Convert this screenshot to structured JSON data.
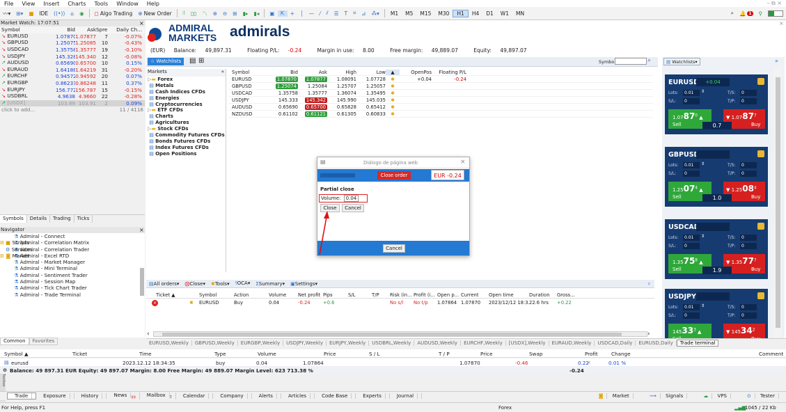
{
  "menu": [
    "File",
    "View",
    "Insert",
    "Charts",
    "Tools",
    "Window",
    "Help"
  ],
  "window_controls": "– ⧉ ×",
  "toolbar": {
    "ide": "IDE",
    "algo_trading": "Algo Trading",
    "new_order": "New Order",
    "timeframes": [
      "M1",
      "M5",
      "M15",
      "M30",
      "H1",
      "H4",
      "D1",
      "W1",
      "MN"
    ],
    "active_timeframe": "H1",
    "notification_count": "1"
  },
  "market_watch": {
    "title": "Market Watch: 17:07:51",
    "columns": [
      "Symbol",
      "Bid",
      "Ask",
      "Spre...",
      "Daily Ch..."
    ],
    "rows": [
      {
        "symbol": "EURUSD",
        "bid": "1.07870",
        "ask": "1.07877",
        "spread": "7",
        "change": "-0.07%"
      },
      {
        "symbol": "GBPUSD",
        "bid": "1.25075",
        "ask": "1.25085",
        "spread": "10",
        "change": "-0.43%"
      },
      {
        "symbol": "USDCAD",
        "bid": "1.35758",
        "ask": "1.35777",
        "spread": "19",
        "change": "-0.10%"
      },
      {
        "symbol": "USDJPY",
        "bid": "145.328",
        "ask": "145.340",
        "spread": "12",
        "change": "-0.08%"
      },
      {
        "symbol": "AUDUSD",
        "bid": "0.65690",
        "ask": "0.65700",
        "spread": "10",
        "change": "0.15%"
      },
      {
        "symbol": "EURAUD",
        "bid": "1.64188",
        "ask": "1.64219",
        "spread": "31",
        "change": "-0.20%"
      },
      {
        "symbol": "EURCHF",
        "bid": "0.94572",
        "ask": "0.94592",
        "spread": "20",
        "change": "0.07%"
      },
      {
        "symbol": "EURGBP",
        "bid": "0.86237",
        "ask": "0.86248",
        "spread": "11",
        "change": "0.37%"
      },
      {
        "symbol": "EURJPY",
        "bid": "156.772",
        "ask": "156.787",
        "spread": "15",
        "change": "-0.15%"
      },
      {
        "symbol": "USDBRL",
        "bid": "4.9638",
        "ask": "4.9660",
        "spread": "22",
        "change": "-0.28%"
      },
      {
        "symbol": "[USDX]",
        "bid": "103.89",
        "ask": "103.91",
        "spread": "2",
        "change": "0.09%"
      }
    ],
    "add_row": "click to add...",
    "count": "11 / 4116",
    "tabs": [
      "Symbols",
      "Details",
      "Trading",
      "Ticks"
    ]
  },
  "navigator": {
    "title": "Navigator",
    "items": [
      "Admiral - Connect",
      "Admiral - Correlation Matrix",
      "Admiral - Correlation Trader",
      "Admiral - Excel RTD",
      "Admiral - Market Manager",
      "Admiral - Mini Terminal",
      "Admiral - Sentiment Trader",
      "Admiral - Session Map",
      "Admiral - Tick Chart Trader",
      "Admiral - Trade Terminal"
    ],
    "folders": [
      "Scripts",
      "Services",
      "Market"
    ],
    "tabs": [
      "Common",
      "Favorites"
    ]
  },
  "brand": {
    "logo_line1": "ADMIRAL",
    "logo_line2": "MARKETS",
    "logo_word": "admirals"
  },
  "account": {
    "currency": "(EUR)",
    "balance_label": "Balance:",
    "balance": "49,897.31",
    "fpl_label": "Floating P/L:",
    "fpl": "-0.24",
    "margin_label": "Margin in use:",
    "margin": "8.00",
    "free_label": "Free margin:",
    "free": "49,889.07",
    "equity_label": "Equity:",
    "equity": "49,897.07"
  },
  "watchlist": {
    "tab_label": "Watchlists",
    "symbol_label": "Symbol:",
    "markets_title": "Markets",
    "markets": [
      "Forex",
      "Metals",
      "Cash Indices CFDs",
      "Energies",
      "Cryptocurrencies",
      "ETF CFDs",
      "Charts",
      "Agricultures",
      "Stock CFDs",
      "Commodity Futures CFDs",
      "Bonds Futures CFDs",
      "Index Futures CFDs",
      "Open Positions"
    ],
    "columns": [
      "Symbol",
      "Bid",
      "Ask",
      "High",
      "Low",
      "▲",
      "OpenPos",
      "Floating P/L"
    ],
    "rows": [
      {
        "symbol": "EURUSD",
        "bid": "1.07870",
        "ask": "1.07877",
        "high": "1.08091",
        "low": "1.07728",
        "openpos": "+0.04",
        "fpl": "-0.24",
        "bid_style": "pg",
        "ask_style": "pg"
      },
      {
        "symbol": "GBPUSD",
        "bid": "1.25074",
        "ask": "1.25084",
        "high": "1.25707",
        "low": "1.25057",
        "openpos": "",
        "fpl": "",
        "bid_style": "pg",
        "ask_style": ""
      },
      {
        "symbol": "USDCAD",
        "bid": "1.35758",
        "ask": "1.35777",
        "high": "1.36074",
        "low": "1.35495",
        "openpos": "",
        "fpl": "",
        "bid_style": "",
        "ask_style": ""
      },
      {
        "symbol": "USDJPY",
        "bid": "145.333",
        "ask": "145.342",
        "high": "145.990",
        "low": "145.035",
        "openpos": "",
        "fpl": "",
        "bid_style": "",
        "ask_style": "pr"
      },
      {
        "symbol": "AUDUSD",
        "bid": "0.65690",
        "ask": "0.65700",
        "high": "0.65828",
        "low": "0.65412",
        "openpos": "",
        "fpl": "",
        "bid_style": "",
        "ask_style": "pr"
      },
      {
        "symbol": "NZDUSD",
        "bid": "0.61102",
        "ask": "0.61121",
        "high": "0.61305",
        "low": "0.60833",
        "openpos": "",
        "fpl": "",
        "bid_style": "",
        "ask_style": "pg"
      }
    ]
  },
  "dialog": {
    "title": "Diálogo de página web",
    "close_order": "Close order",
    "amount": "EUR -0.24",
    "partial": "Partial close",
    "volume_label": "Volume:",
    "volume_value": "0.04",
    "close_btn": "Close",
    "cancel_btn": "Cancel",
    "cancel_bottom": "Cancel"
  },
  "orders": {
    "toolbar": [
      "All orders",
      "Close",
      "Tools",
      "OCA",
      "Summary",
      "Settings"
    ],
    "columns": [
      "Ticket ▲",
      "",
      "Symbol",
      "Action",
      "Volume",
      "Net profit",
      "Pips",
      "S/L",
      "T/P",
      "Risk (in...",
      "Profit (i...",
      "Open p...",
      "Current",
      "Open time",
      "Duration",
      "Gross..."
    ],
    "row": [
      "",
      "",
      "EURUSD",
      "Buy",
      "0.04",
      "-0.24",
      "+0.6",
      "",
      "",
      "No s/l",
      "No t/p",
      "1.07864",
      "1.07870",
      "2023/12/12 18:3...",
      "22.6 hrs",
      "+0.22"
    ]
  },
  "chart_tabs": [
    "EURUSD,Weekly",
    "GBPUSD,Weekly",
    "EURGBP,Weekly",
    "USDJPY,Weekly",
    "EURJPY,Weekly",
    "USDBRL,Weekly",
    "AUDUSD,Weekly",
    "EURCHF,Weekly",
    "[USDX],Weekly",
    "EURAUD,Weekly",
    "USDCAD,Daily",
    "EURUSD,Daily",
    "Trade terminal"
  ],
  "panels": [
    {
      "name": "EURUSD",
      "change": "+0.04",
      "lots": "0.01",
      "ts": "0",
      "sl": "0",
      "tp": "0",
      "sell_small": "1.07",
      "sell_big": "87",
      "sell_sup": "0",
      "buy_small": "1.07",
      "buy_big": "87",
      "buy_sup": "7",
      "spread": "0.7",
      "sell": "Sell",
      "buy": "Buy"
    },
    {
      "name": "GBPUSD",
      "change": "",
      "lots": "0.01",
      "ts": "0",
      "sl": "0",
      "tp": "0",
      "sell_small": "1.25",
      "sell_big": "07",
      "sell_sup": "4",
      "buy_small": "1.25",
      "buy_big": "08",
      "buy_sup": "4",
      "spread": "1.0",
      "sell": "Sell",
      "buy": "Buy"
    },
    {
      "name": "USDCAD",
      "change": "",
      "lots": "0.01",
      "ts": "0",
      "sl": "0",
      "tp": "0",
      "sell_small": "1.35",
      "sell_big": "75",
      "sell_sup": "8",
      "buy_small": "1.35",
      "buy_big": "77",
      "buy_sup": "7",
      "spread": "1.9",
      "sell": "Sell",
      "buy": "Buy"
    },
    {
      "name": "USDJPY",
      "change": "",
      "lots": "0.01",
      "ts": "0",
      "sl": "0",
      "tp": "0",
      "sell_small": "145",
      "sell_big": "33",
      "sell_sup": "3",
      "buy_small": "145",
      "buy_big": "34",
      "buy_sup": "2",
      "spread": "",
      "sell": "Sell",
      "buy": "Buy"
    }
  ],
  "panel_labels": {
    "lots": "Lots:",
    "ts": "T/S:",
    "sl": "S/L:",
    "tp": "T/P:"
  },
  "terminal": {
    "columns": [
      "Symbol ▲",
      "Ticket",
      "Time",
      "Type",
      "Volume",
      "Price",
      "S / L",
      "T / P",
      "Price",
      "Swap",
      "Profit",
      "Change",
      "Comment"
    ],
    "row": [
      "eurusd",
      "",
      "2023.12.12 18:34:35",
      "buy",
      "0.04",
      "1.07864",
      "",
      "",
      "1.07870",
      "-0.46",
      "0.22",
      "0.01 %",
      ""
    ],
    "balance": "Balance: 49 897.31 EUR  Equity: 49 897.07  Margin: 8.00  Free Margin: 49 889.07  Margin Level: 623 713.38 %",
    "balance_profit": "-0.24",
    "tabs": [
      "Trade",
      "Exposure",
      "History",
      "News",
      "Mailbox",
      "Calendar",
      "Company",
      "Alerts",
      "Articles",
      "Code Base",
      "Experts",
      "Journal"
    ],
    "news_count": "99",
    "mailbox_count": "7",
    "right_items": [
      "Market",
      "Signals",
      "VPS",
      "Tester"
    ]
  },
  "status": {
    "help": "For Help, press F1",
    "profile": "Forex",
    "traffic": "1045 / 22 Kb"
  }
}
